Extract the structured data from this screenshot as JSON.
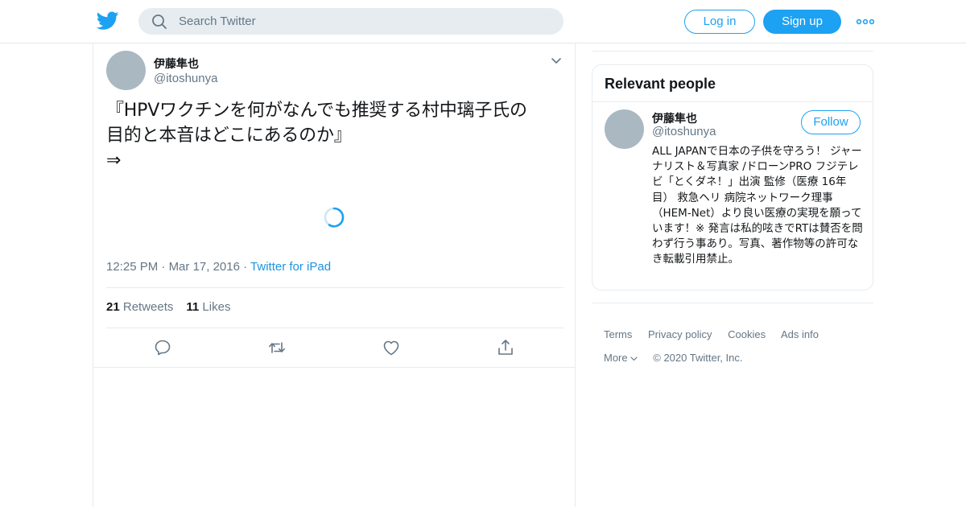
{
  "header": {
    "search_placeholder": "Search Twitter",
    "login_label": "Log in",
    "signup_label": "Sign up",
    "brand_color": "#1da1f2"
  },
  "tweet": {
    "author_name": "伊藤隼也",
    "author_handle": "@itoshunya",
    "text_line1": "『HPVワクチンを何がなんでも推奨する村中璃子氏の",
    "text_line2": "目的と本音はどこにあるのか』",
    "text_line3": "⇒",
    "time": "12:25 PM",
    "date": "Mar 17, 2016",
    "source": "Twitter for iPad",
    "retweets_count": "21",
    "retweets_label": "Retweets",
    "likes_count": "11",
    "likes_label": "Likes"
  },
  "relevant_people": {
    "title": "Relevant people",
    "person": {
      "name": "伊藤隼也",
      "handle": "@itoshunya",
      "follow_label": "Follow",
      "bio": "ALL JAPANで日本の子供を守ろう！ ジャーナリスト＆写真家 /ドローンPRO フジテレビ「とくダネ！」出演 監修（医療 16年目） 救急ヘリ 病院ネットワーク理事（HEM-Net）より良い医療の実現を願っています！※ 発言は私的呟きでRTは賛否を問わず行う事あり。写真、著作物等の許可なき転載引用禁止。"
    }
  },
  "footer": {
    "terms": "Terms",
    "privacy": "Privacy policy",
    "cookies": "Cookies",
    "ads": "Ads info",
    "more": "More",
    "copyright": "© 2020 Twitter, Inc."
  }
}
